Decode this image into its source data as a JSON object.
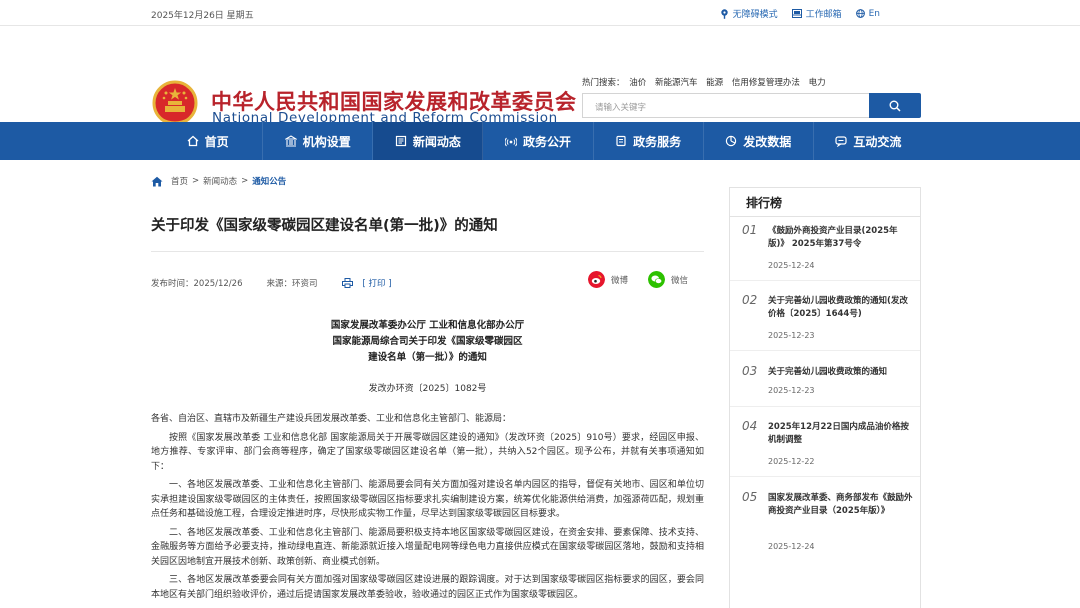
{
  "topbar": {
    "date": "2025年12月26日 星期五",
    "links": [
      {
        "label": "无障碍模式",
        "icon": "accessibility-icon"
      },
      {
        "label": "工作邮箱",
        "icon": "mail-icon"
      },
      {
        "label": "En",
        "icon": "globe-icon"
      }
    ]
  },
  "header": {
    "site_cn": "中华人民共和国国家发展和改革委员会",
    "site_en": "National Development and Reform Commission",
    "hot_label": "热门搜索：",
    "hot_terms": [
      "油价",
      "新能源汽车",
      "能源",
      "信用修复管理办法",
      "电力"
    ],
    "search_placeholder": "请输入关键字"
  },
  "nav": {
    "items": [
      {
        "label": "首页",
        "icon": "home-icon"
      },
      {
        "label": "机构设置",
        "icon": "building-icon"
      },
      {
        "label": "新闻动态",
        "icon": "news-icon"
      },
      {
        "label": "政务公开",
        "icon": "broadcast-icon"
      },
      {
        "label": "政务服务",
        "icon": "service-icon"
      },
      {
        "label": "发改数据",
        "icon": "pie-chart-icon"
      },
      {
        "label": "互动交流",
        "icon": "chat-icon"
      }
    ],
    "active": "新闻动态"
  },
  "breadcrumb": {
    "items": [
      "首页",
      ">",
      "新闻动态",
      ">"
    ],
    "current": "通知公告"
  },
  "article": {
    "title": "关于印发《国家级零碳园区建设名单(第一批)》的通知",
    "publish": "发布时间：2025/12/26",
    "source": "来源：环资司",
    "print": "[ 打印 ]",
    "share_weibo": "微博",
    "share_wechat": "微信",
    "head_lines": [
      "国家发展改革委办公厅 工业和信息化部办公厅",
      "国家能源局综合司关于印发《国家级零碳园区",
      "建设名单（第一批）》的通知"
    ],
    "doc_number": "发改办环资〔2025〕1082号",
    "paragraphs": [
      {
        "text": "各省、自治区、直辖市及新疆生产建设兵团发展改革委、工业和信息化主管部门、能源局：",
        "indent": false
      },
      {
        "text": "按照《国家发展改革委 工业和信息化部 国家能源局关于开展零碳园区建设的通知》（发改环资〔2025〕910号）要求，经园区申报、地方推荐、专家评审、部门会商等程序，确定了国家级零碳园区建设名单（第一批），共纳入52个园区。现予公布，并就有关事项通知如下：",
        "indent": true
      },
      {
        "text": "一、各地区发展改革委、工业和信息化主管部门、能源局要会同有关方面加强对建设名单内园区的指导，督促有关地市、园区和单位切实承担建设国家级零碳园区的主体责任，按照国家级零碳园区指标要求扎实编制建设方案，统筹优化能源供给消费，加强源荷匹配，规划重点任务和基础设施工程，合理设定推进时序，尽快形成实物工作量，尽早达到国家级零碳园区目标要求。",
        "indent": true
      },
      {
        "text": "二、各地区发展改革委、工业和信息化主管部门、能源局要积极支持本地区国家级零碳园区建设，在资金安排、要素保障、技术支持、金融服务等方面给予必要支持，推动绿电直连、新能源就近接入增量配电网等绿色电力直接供应模式在国家级零碳园区落地，鼓励和支持相关园区因地制宜开展技术创新、政策创新、商业模式创新。",
        "indent": true
      },
      {
        "text": "三、各地区发展改革委要会同有关方面加强对国家级零碳园区建设进展的跟踪调度。对于达到国家级零碳园区指标要求的园区，要会同本地区有关部门组织验收评价，通过后提请国家发展改革委验收，验收通过的园区正式作为国家级零碳园区。",
        "indent": true
      }
    ]
  },
  "sidebar": {
    "title": "排行榜",
    "items": [
      {
        "no": "01",
        "text": "《鼓励外商投资产业目录(2025年版)》 2025年第37号令",
        "date": "2025-12-24"
      },
      {
        "no": "02",
        "text": "关于完善幼儿园收费政策的通知(发改价格〔2025〕1644号)",
        "date": "2025-12-23"
      },
      {
        "no": "03",
        "text": "关于完善幼儿园收费政策的通知",
        "date": "2025-12-23"
      },
      {
        "no": "04",
        "text": "2025年12月22日国内成品油价格按机制调整",
        "date": "2025-12-22"
      },
      {
        "no": "05",
        "text": "国家发展改革委、商务部发布《鼓励外商投资产业目录（2025年版）》",
        "date": "2025-12-24"
      }
    ]
  },
  "colors": {
    "brand_blue": "#1d5aa4",
    "title_red": "#b8232b",
    "weibo": "#e6162d",
    "wechat": "#2dc100"
  }
}
